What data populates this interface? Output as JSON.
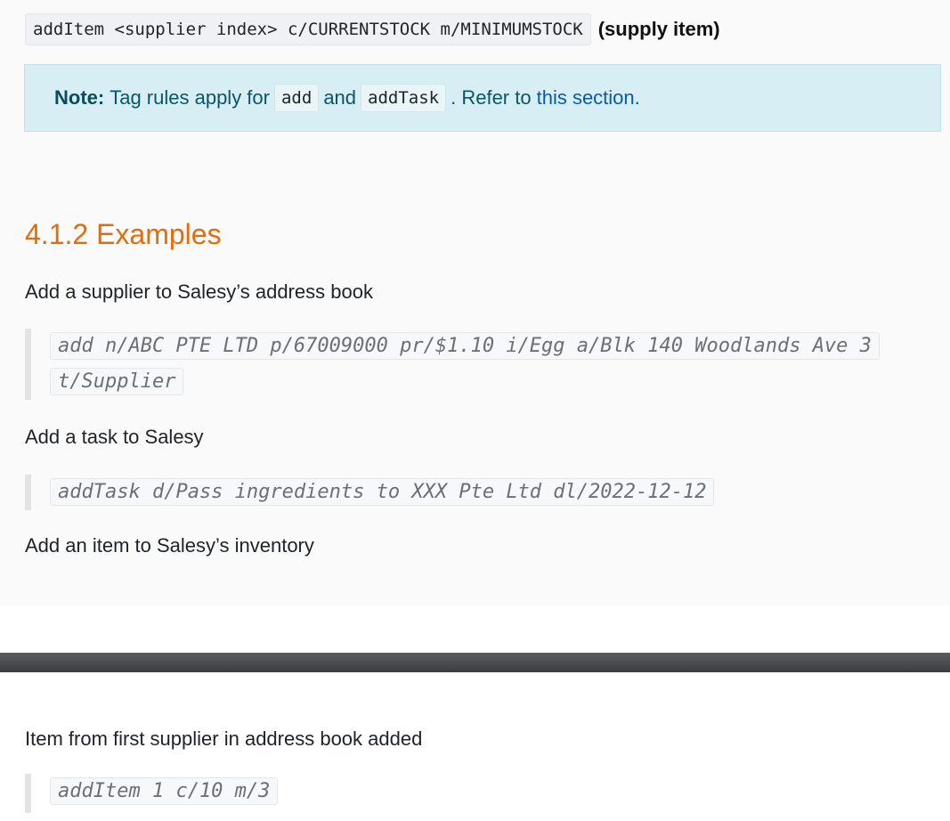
{
  "format": {
    "command": "addItem <supplier index> c/CURRENTSTOCK m/MINIMUMSTOCK",
    "suffix": "(supply item)"
  },
  "note": {
    "label": "Note:",
    "text1": "Tag rules apply for",
    "code1": "add",
    "text2": "and",
    "code2": "addTask",
    "text3": ". Refer to",
    "link": "this section",
    "text4": "."
  },
  "section": {
    "heading": "4.1.2 Examples"
  },
  "examples": [
    {
      "description": "Add a supplier to Salesy’s address book",
      "command_line1": "add n/ABC PTE LTD p/67009000 pr/$1.10 i/Egg a/Blk 140 Woodlands Ave 3",
      "command_line2": "t/Supplier"
    },
    {
      "description": "Add a task to Salesy",
      "command": "addTask d/Pass ingredients to XXX Pte Ltd dl/2022-12-12"
    },
    {
      "description": "Add an item to Salesy’s inventory"
    }
  ],
  "result": {
    "description": "Item from first supplier in address book added",
    "command": "addItem 1 c/10 m/3"
  }
}
